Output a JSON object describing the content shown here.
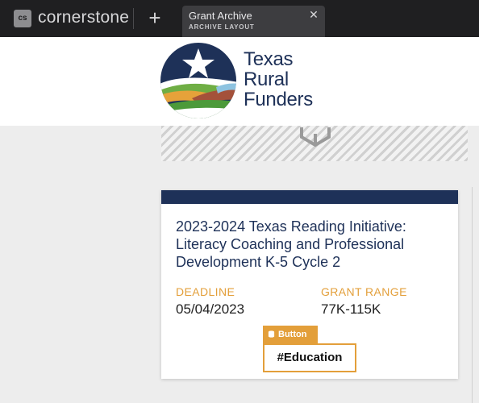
{
  "app": {
    "logo_text": "cs",
    "brand": "cornerstone",
    "new_tab_glyph": "+",
    "tab": {
      "title": "Grant Archive",
      "subtitle": "ARCHIVE LAYOUT",
      "close_glyph": "✕"
    }
  },
  "site": {
    "logo_lines": [
      "Texas",
      "Rural",
      "Funders"
    ]
  },
  "card": {
    "title": "2023-2024 Texas Reading Initiative: Literacy Coaching and Professional Development K-5 Cycle 2",
    "deadline_label": "DEADLINE",
    "deadline_value": "05/04/2023",
    "range_label": "GRANT RANGE",
    "range_value": "77K-115K",
    "element_tag": "Button",
    "tag_button": "#Education"
  },
  "colors": {
    "navy": "#1e3158",
    "accent": "#e39f3a",
    "topbar": "#1f1f21"
  },
  "icons": [
    "cornerstone-logo",
    "plus-icon",
    "close-icon",
    "cube-icon",
    "database-icon",
    "texas-star-logo"
  ]
}
